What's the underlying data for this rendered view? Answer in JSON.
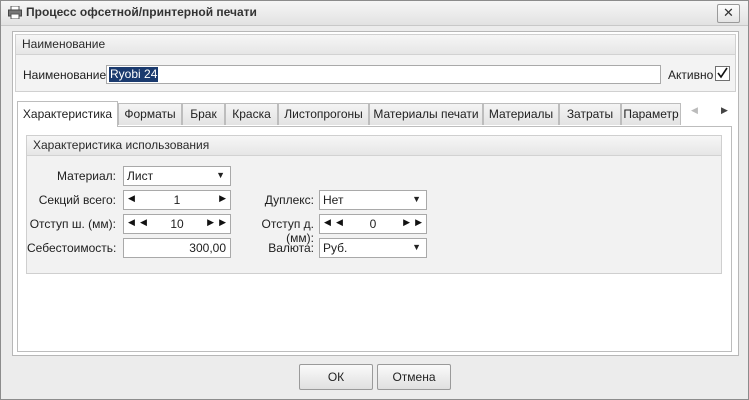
{
  "window": {
    "title": "Процесс офсетной/принтерной печати",
    "close": "✕"
  },
  "name_section": {
    "header": "Наименование",
    "label": "Наименование:",
    "value": "Ryobi 24",
    "active_label": "Активно",
    "active_checked": true
  },
  "tabs": [
    {
      "label": "Характеристика",
      "active": true
    },
    {
      "label": "Форматы"
    },
    {
      "label": "Брак"
    },
    {
      "label": "Краска"
    },
    {
      "label": "Листопрогоны"
    },
    {
      "label": "Материалы печати"
    },
    {
      "label": "Материалы"
    },
    {
      "label": "Затраты"
    },
    {
      "label": "Параметр"
    }
  ],
  "char_section": {
    "header": "Характеристика использования",
    "material": {
      "label": "Материал:",
      "value": "Лист"
    },
    "sections": {
      "label": "Секций всего:",
      "value": "1"
    },
    "duplex": {
      "label": "Дуплекс:",
      "value": "Нет"
    },
    "indent_w": {
      "label": "Отступ ш. (мм):",
      "value": "10"
    },
    "indent_d": {
      "label": "Отступ д. (мм):",
      "value": "0"
    },
    "cost": {
      "label": "Себестоимость:",
      "value": "300,00"
    },
    "currency": {
      "label": "Валюта:",
      "value": "Руб."
    }
  },
  "buttons": {
    "ok": "ОК",
    "cancel": "Отмена"
  }
}
